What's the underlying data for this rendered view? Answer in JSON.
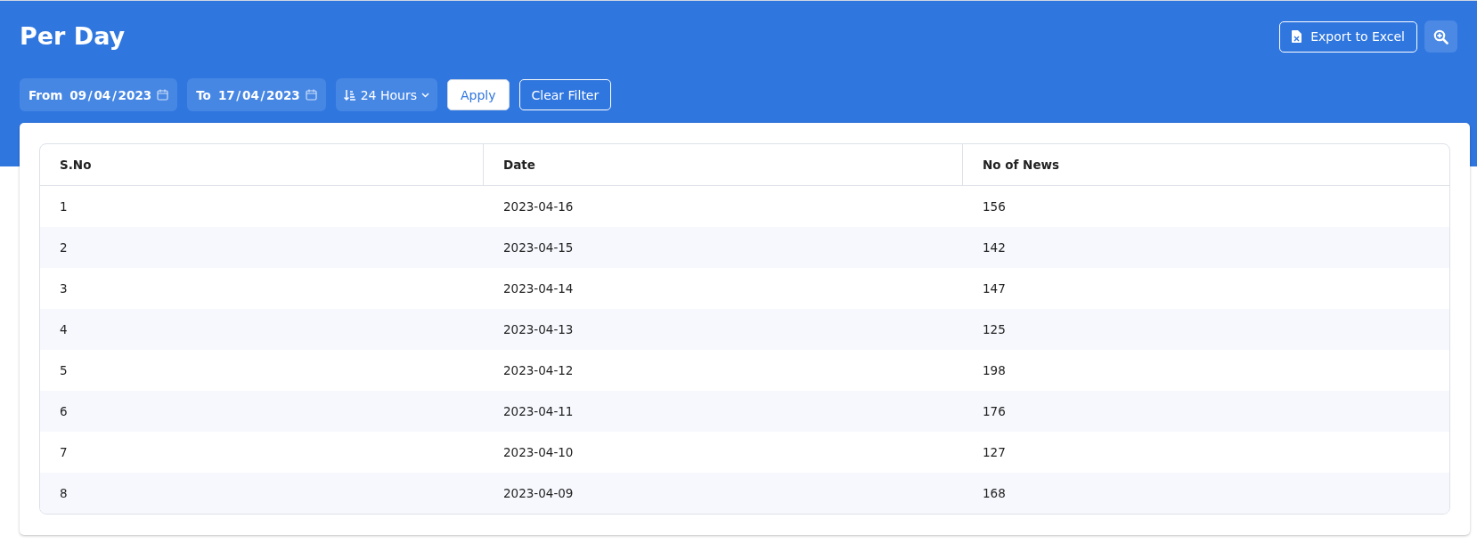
{
  "page": {
    "title": "Per Day"
  },
  "actions": {
    "export_label": "Export to Excel"
  },
  "filters": {
    "from": {
      "label": "From",
      "value": "09 / 04 / 2023"
    },
    "to": {
      "label": "To",
      "value": "17 / 04 / 2023"
    },
    "period": {
      "value": "24 Hours"
    },
    "apply_label": "Apply",
    "clear_label": "Clear Filter"
  },
  "table": {
    "columns": [
      "S.No",
      "Date",
      "No of News"
    ],
    "rows": [
      [
        "1",
        "2023-04-16",
        "156"
      ],
      [
        "2",
        "2023-04-15",
        "142"
      ],
      [
        "3",
        "2023-04-14",
        "147"
      ],
      [
        "4",
        "2023-04-13",
        "125"
      ],
      [
        "5",
        "2023-04-12",
        "198"
      ],
      [
        "6",
        "2023-04-11",
        "176"
      ],
      [
        "7",
        "2023-04-10",
        "127"
      ],
      [
        "8",
        "2023-04-09",
        "168"
      ]
    ]
  }
}
